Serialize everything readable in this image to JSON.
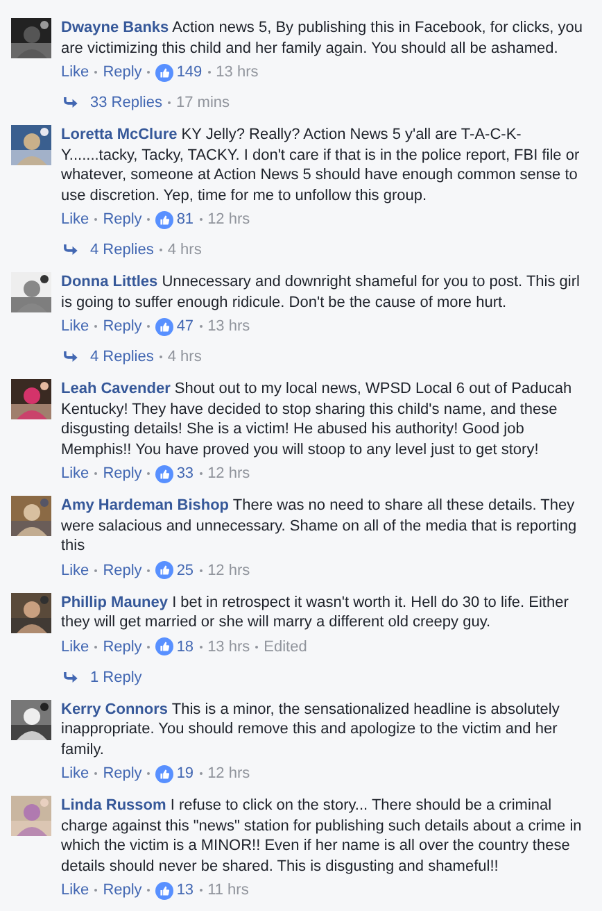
{
  "comments": [
    {
      "author": "Dwayne Banks",
      "text": "Action news 5, By publishing this in Facebook, for clicks, you are victimizing this child and her family again. You should all be ashamed.",
      "like": "Like",
      "reply": "Reply",
      "reactions": "149",
      "time": "13 hrs",
      "replies": {
        "count": "33 Replies",
        "time": "17 mins"
      }
    },
    {
      "author": "Loretta McClure",
      "text": "KY Jelly? Really? Action News 5 y'all are T-A-C-K-Y.......tacky, Tacky, TACKY. I don't care if that is in the police report, FBI file or whatever, someone at Action News 5 should have enough common sense to use discretion. Yep, time for me to unfollow this group.",
      "like": "Like",
      "reply": "Reply",
      "reactions": "81",
      "time": "12 hrs",
      "replies": {
        "count": "4 Replies",
        "time": "4 hrs"
      }
    },
    {
      "author": "Donna Littles",
      "text": "Unnecessary and downright shameful for you to post. This girl is going to suffer enough ridicule. Don't be the cause of more hurt.",
      "like": "Like",
      "reply": "Reply",
      "reactions": "47",
      "time": "13 hrs",
      "replies": {
        "count": "4 Replies",
        "time": "4 hrs"
      }
    },
    {
      "author": "Leah Cavender",
      "text": "Shout out to my local news, WPSD Local 6 out of Paducah Kentucky! They have decided to stop sharing this child's name, and these disgusting details! She is a victim! He abused his authority! Good job Memphis!! You have proved you will stoop to any level just to get story!",
      "like": "Like",
      "reply": "Reply",
      "reactions": "33",
      "time": "12 hrs"
    },
    {
      "author": "Amy Hardeman Bishop",
      "text": "There was no need to share all these details. They were salacious and unnecessary. Shame on all of the media that is reporting this",
      "like": "Like",
      "reply": "Reply",
      "reactions": "25",
      "time": "12 hrs"
    },
    {
      "author": "Phillip Mauney",
      "text": "I bet in retrospect it wasn't worth it. Hell do 30 to life. Either they will get married or she will marry a different old creepy guy.",
      "like": "Like",
      "reply": "Reply",
      "reactions": "18",
      "time": "13 hrs",
      "edited": "Edited",
      "replies": {
        "count": "1 Reply"
      }
    },
    {
      "author": "Kerry Connors",
      "text": "This is a minor, the sensationalized headline is absolutely inappropriate. You should remove this and apologize to the victim and her family.",
      "like": "Like",
      "reply": "Reply",
      "reactions": "19",
      "time": "12 hrs"
    },
    {
      "author": "Linda Russom",
      "text": "I refuse to click on the story... There should be a criminal charge against this \"news\" station for publishing such details about a crime in which the victim is a MINOR!! Even if her name is all over the country these details should never be shared. This is disgusting and shameful!!",
      "like": "Like",
      "reply": "Reply",
      "reactions": "13",
      "time": "11 hrs"
    }
  ]
}
